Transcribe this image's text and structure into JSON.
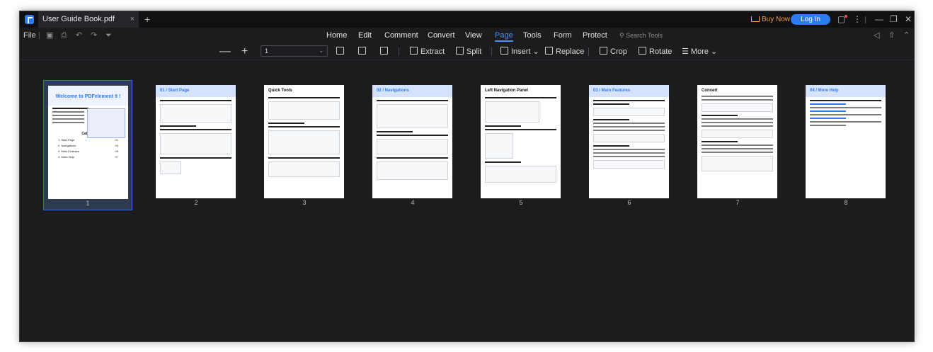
{
  "titlebar": {
    "doc_tab": "User Guide Book.pdf",
    "close_tab": "×",
    "new_tab": "+",
    "buy_now": "Buy Now",
    "log_in": "Log In",
    "more": "⋮",
    "minimize": "—",
    "restore": "❐",
    "close": "✕"
  },
  "menubar": {
    "file": "File",
    "menus": [
      "Home",
      "Edit",
      "Comment",
      "Convert",
      "View",
      "Page",
      "Tools",
      "Form",
      "Protect"
    ],
    "active_menu": "Page",
    "search": "Search Tools"
  },
  "toolbar": {
    "zoom_out": "—",
    "zoom_in": "+",
    "page_value": "1",
    "extract": "Extract",
    "split": "Split",
    "insert": "Insert",
    "replace": "Replace",
    "crop": "Crop",
    "rotate": "Rotate",
    "more": "More"
  },
  "pages": [
    {
      "number": "1",
      "title": "Welcome to PDFelement 9 !",
      "selected": true
    },
    {
      "number": "2",
      "title": "01 / Start Page"
    },
    {
      "number": "3",
      "title": "Quick Tools"
    },
    {
      "number": "4",
      "title": "02 / Navigations"
    },
    {
      "number": "5",
      "title": "Left Navigation Panel"
    },
    {
      "number": "6",
      "title": "03 / Main Features"
    },
    {
      "number": "7",
      "title": "Convert"
    },
    {
      "number": "8",
      "title": "04 / More Help"
    }
  ],
  "cover": {
    "catalog": "Catalog",
    "items": [
      {
        "label": "1. Start Page",
        "page": "01"
      },
      {
        "label": "2. Navigations",
        "page": "03"
      },
      {
        "label": "3. Main Features",
        "page": "05"
      },
      {
        "label": "4. More Help",
        "page": "07"
      }
    ]
  },
  "colors": {
    "accent": "#2d7cf6",
    "active_menu": "#4a90ff",
    "buy_now": "#f29a44",
    "background": "#1b1c1e"
  }
}
